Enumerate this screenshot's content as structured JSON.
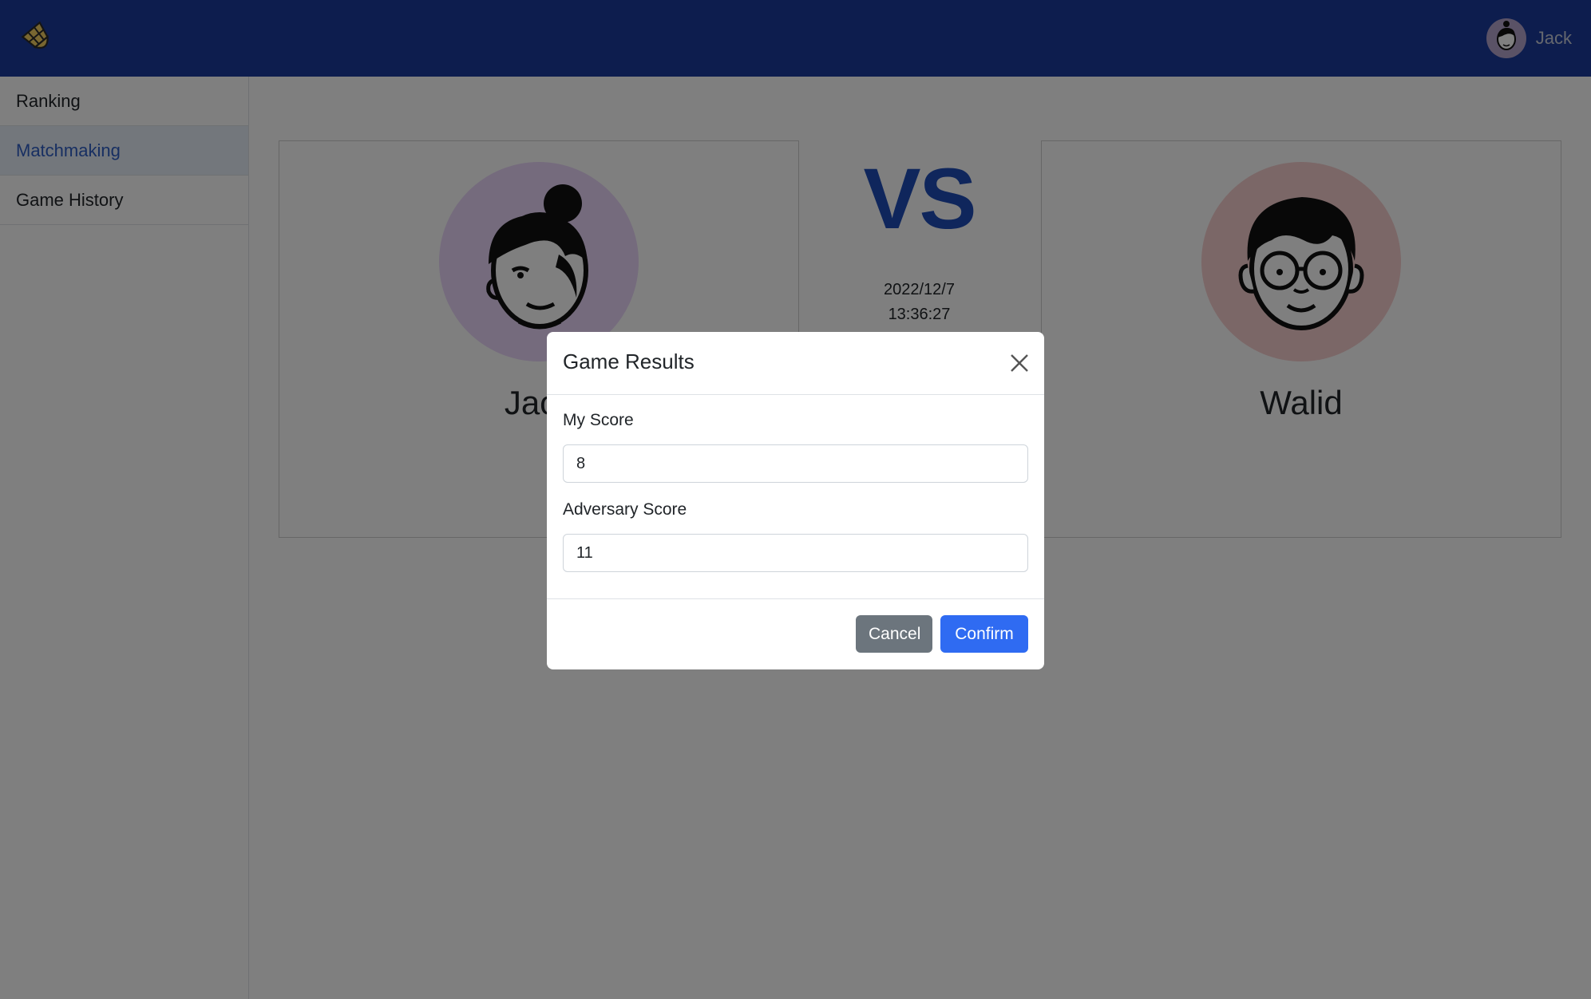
{
  "header": {
    "logo_icon": "shuttlecock-icon",
    "user": {
      "name": "Jack",
      "avatar_icon": "user-avatar-icon"
    }
  },
  "sidebar": {
    "items": [
      {
        "label": "Ranking",
        "active": false
      },
      {
        "label": "Matchmaking",
        "active": true
      },
      {
        "label": "Game History",
        "active": false
      }
    ]
  },
  "match": {
    "player_left": {
      "name": "Jack",
      "avatar_icon": "woman-avatar-icon",
      "avatar_color": "#ead7fa"
    },
    "vs_label": "VS",
    "date": "2022/12/7",
    "time": "13:36:27",
    "player_right": {
      "name": "Walid",
      "avatar_icon": "man-glasses-avatar-icon",
      "avatar_color": "#f7cfcf"
    }
  },
  "modal": {
    "title": "Game Results",
    "fields": [
      {
        "label": "My Score",
        "value": "8"
      },
      {
        "label": "Adversary Score",
        "value": "11"
      }
    ],
    "cancel_label": "Cancel",
    "confirm_label": "Confirm"
  },
  "colors": {
    "header_bg": "#1a3a9c",
    "accent": "#1f4db8",
    "confirm": "#2f6bf2",
    "cancel": "#6c757d"
  }
}
